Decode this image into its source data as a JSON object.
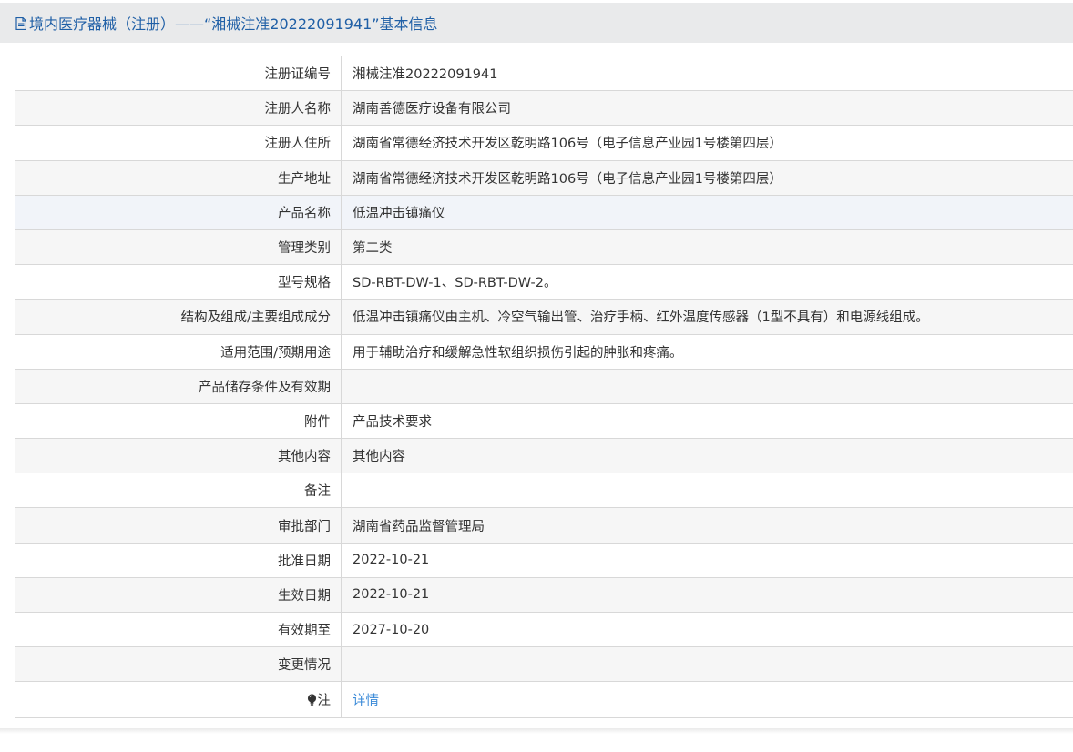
{
  "header": {
    "icon": "document-icon",
    "title": "境内医疗器械（注册）——“湘械注准20222091941”基本信息"
  },
  "rows": [
    {
      "label": "注册证编号",
      "value": "湘械注准20222091941"
    },
    {
      "label": "注册人名称",
      "value": "湖南善德医疗设备有限公司"
    },
    {
      "label": "注册人住所",
      "value": "湖南省常德经济技术开发区乾明路106号（电子信息产业园1号楼第四层）"
    },
    {
      "label": "生产地址",
      "value": "湖南省常德经济技术开发区乾明路106号（电子信息产业园1号楼第四层）"
    },
    {
      "label": "产品名称",
      "value": "低温冲击镇痛仪"
    },
    {
      "label": "管理类别",
      "value": "第二类"
    },
    {
      "label": "型号规格",
      "value": "SD-RBT-DW-1、SD-RBT-DW-2。"
    },
    {
      "label": "结构及组成/主要组成成分",
      "value": "低温冲击镇痛仪由主机、冷空气输出管、治疗手柄、红外温度传感器（1型不具有）和电源线组成。"
    },
    {
      "label": "适用范围/预期用途",
      "value": "用于辅助治疗和缓解急性软组织损伤引起的肿胀和疼痛。"
    },
    {
      "label": "产品储存条件及有效期",
      "value": ""
    },
    {
      "label": "附件",
      "value": "产品技术要求"
    },
    {
      "label": "其他内容",
      "value": "其他内容"
    },
    {
      "label": "备注",
      "value": ""
    },
    {
      "label": "审批部门",
      "value": "湖南省药品监督管理局"
    },
    {
      "label": "批准日期",
      "value": "2022-10-21"
    },
    {
      "label": "生效日期",
      "value": "2022-10-21"
    },
    {
      "label": "有效期至",
      "value": "2027-10-20"
    },
    {
      "label": "变更情况",
      "value": ""
    }
  ],
  "note_row": {
    "icon": "lightbulb-icon",
    "label": "注",
    "link_text": "详情"
  },
  "colors": {
    "title": "#1f5fa6",
    "link": "#3a8ad8",
    "header_bg": "#e9eaeb",
    "border": "#d8d8d8"
  }
}
